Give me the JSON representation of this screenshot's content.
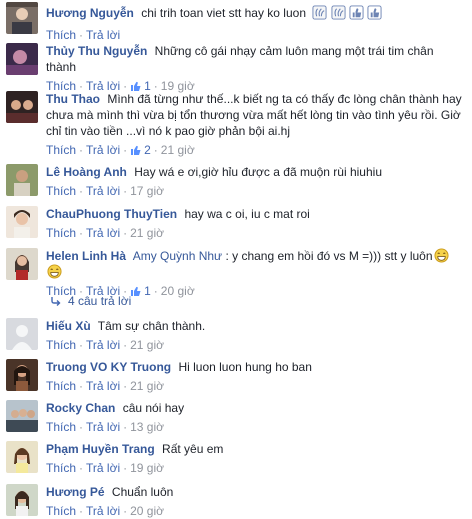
{
  "ui": {
    "like": "Thích",
    "reply": "Trả lời",
    "sep": "·"
  },
  "comments": [
    {
      "author": "Hương Nguyễn",
      "text": "chi trih toan viet stt hay ko luon",
      "emoji": [
        "wave-hand-icon",
        "wave-hand-icon",
        "thumbs-up-icon",
        "thumbs-up-icon"
      ],
      "likes": "",
      "time": ""
    },
    {
      "author": "Thủy Thu Nguyễn",
      "text": "Những cô gái nhạy cảm luôn mang một trái tim chân thành",
      "likes": "1",
      "time": "19 giờ"
    },
    {
      "author": "Thu Thao",
      "text": "Mình đã từng như thế...k biết ng ta có thấy đc lòng chân thành hay chưa mà mình thì vừa bị tổn thương vừa mất hết lòng tin vào tình yêu rồi. Giờ chỉ tin vào tiền ...vì nó k pao giờ phản bội ai.hj",
      "likes": "2",
      "time": "21 giờ"
    },
    {
      "author": "Lê Hoàng Anh",
      "text": "Hay wá e ơi,giờ hỉu được a đã muộn rùi hiuhiu",
      "likes": "",
      "time": "17 giờ"
    },
    {
      "author": "ChauPhuong ThuyTien",
      "text": "hay wa c oi, iu c mat roi",
      "likes": "",
      "time": "21 giờ"
    },
    {
      "author": "Helen Linh Hà",
      "mention": "Amy Quỳnh Như",
      "text": ": y chang em hồi đó vs M =))) stt y luôn",
      "emoji": [
        "grin-icon",
        "grin-icon"
      ],
      "likes": "1",
      "time": "20 giờ"
    },
    {
      "author": "Hiếu Xù",
      "text": "Tâm sự chân thành.",
      "likes": "",
      "time": "21 giờ"
    },
    {
      "author": "Truong VO KY Truong",
      "text": "Hi luon luon hung ho ban",
      "likes": "",
      "time": "21 giờ"
    },
    {
      "author": "Rocky Chan",
      "text": "câu nói hay",
      "likes": "",
      "time": "13 giờ"
    },
    {
      "author": "Phạm Huyền Trang",
      "text": "Rất yêu em",
      "likes": "",
      "time": "19 giờ"
    },
    {
      "author": "Hương Pé",
      "text": "Chuẩn luôn",
      "likes": "",
      "time": "20 giờ"
    }
  ],
  "replies_link": "4 câu trả lời",
  "colors": {
    "link": "#365899",
    "meta": "#90949c",
    "accent": "#4267b2"
  }
}
